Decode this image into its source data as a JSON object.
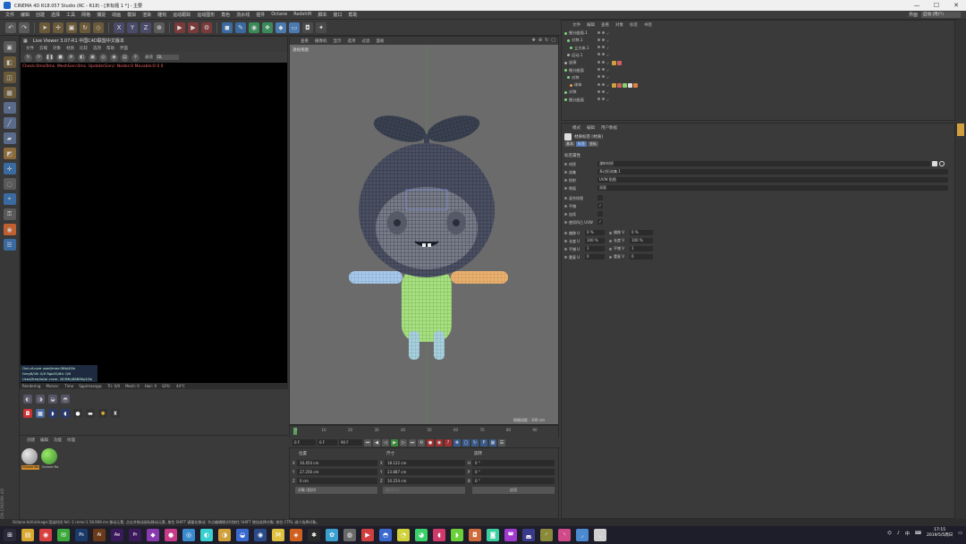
{
  "window": {
    "title": "CINEMA 4D R18.057 Studio (RC - R18) - [末标题 1 *] - 主要",
    "controls": [
      "—",
      "☐",
      "✕"
    ]
  },
  "menubar": {
    "items": [
      "文件",
      "编辑",
      "创建",
      "选择",
      "工具",
      "网格",
      "捕捉",
      "动画",
      "模拟",
      "渲染",
      "雕刻",
      "运动跟踪",
      "运动图形",
      "角色",
      "流水线",
      "插件",
      "Octane",
      "Redshift",
      "脚本",
      "窗口",
      "帮助"
    ],
    "layout_label": "界面",
    "layout_value": "启动 (用户)"
  },
  "toolbar": {
    "items": [
      {
        "name": "undo-icon",
        "glyph": "↶",
        "color": "#5a5a5a"
      },
      {
        "name": "redo-icon",
        "glyph": "↷",
        "color": "#5a5a5a"
      },
      {
        "name": "select-arrow-icon",
        "glyph": "➤",
        "color": "#6a5a3a"
      },
      {
        "name": "move-icon",
        "glyph": "✛",
        "color": "#6a5a3a"
      },
      {
        "name": "scale-icon",
        "glyph": "▣",
        "color": "#6a5a3a"
      },
      {
        "name": "rotate-icon",
        "glyph": "↻",
        "color": "#6a5a3a"
      },
      {
        "name": "recent-tool-icon",
        "glyph": "◇",
        "color": "#6a5a3a"
      },
      {
        "name": "x-axis-icon",
        "glyph": "X",
        "color": "#4a4a6a"
      },
      {
        "name": "y-axis-icon",
        "glyph": "Y",
        "color": "#4a4a6a"
      },
      {
        "name": "z-axis-icon",
        "glyph": "Z",
        "color": "#4a4a6a"
      },
      {
        "name": "coord-system-icon",
        "glyph": "⊕",
        "color": "#5a5a5a"
      },
      {
        "name": "render-view-icon",
        "glyph": "▶",
        "color": "#7a3a3a"
      },
      {
        "name": "render-picture-icon",
        "glyph": "▶",
        "color": "#7a3a3a"
      },
      {
        "name": "render-settings-icon",
        "glyph": "⚙",
        "color": "#7a3a3a"
      },
      {
        "name": "cube-icon",
        "glyph": "◼",
        "color": "#3a6aa0"
      },
      {
        "name": "pen-icon",
        "glyph": "✎",
        "color": "#3a6aa0"
      },
      {
        "name": "subdivision-icon",
        "glyph": "◉",
        "color": "#3a8a5a"
      },
      {
        "name": "cloner-icon",
        "glyph": "❖",
        "color": "#3a8a5a"
      },
      {
        "name": "deformer-icon",
        "glyph": "◆",
        "color": "#4a7ab0"
      },
      {
        "name": "floor-icon",
        "glyph": "▭",
        "color": "#4a7ab0"
      },
      {
        "name": "camera-icon",
        "glyph": "◘",
        "color": "#4a4a4a"
      },
      {
        "name": "light-icon",
        "glyph": "✦",
        "color": "#4a4a4a"
      }
    ]
  },
  "left_tools": [
    "make-editable-icon",
    "model-mode-icon",
    "texture-mode-icon",
    "workplane-icon",
    "point-mode-icon",
    "edge-mode-icon",
    "polygon-mode-icon",
    "uv-mode-icon",
    "axis-mode-icon",
    "soft-select-icon",
    "snap-icon",
    "lock-icon",
    "solo-icon",
    "layers-icon"
  ],
  "live_viewer": {
    "title": "Live Viewer 3.07-R1 中国C4D联盟中文版本",
    "menu": [
      "文件",
      "云端",
      "对象",
      "材质",
      "比较",
      "选项",
      "帮助",
      "界面"
    ],
    "tools_label": "通道",
    "channel": "DL",
    "status": "Check:0ms/0ms. MeshGen:0ms. Update(Gen): Nodes:0 Movable:0  0  0",
    "stats": [
      "Out-of-core used/max:0Kb/4Gb",
      "Grey8/16: 0/0          Rgb32/64: 0/0",
      "Used/free/total vram: 263Mb/888Mb/4Gb"
    ],
    "bottom": [
      "Rendering",
      "Ms/sec:",
      "Time",
      "Spp/maxspp:",
      "Tri: 0/0",
      "Mesh: 0",
      "Hair: 0",
      "GPU:",
      "44°C"
    ]
  },
  "materials": {
    "menu": [
      "创建",
      "编辑",
      "功能",
      "纹理"
    ],
    "items": [
      {
        "label": "Octane Ma",
        "color_a": "#e8e8e8",
        "color_b": "#888888"
      },
      {
        "label": "Octane Ma",
        "color_a": "#9ae86a",
        "color_b": "#3a8a2a"
      }
    ]
  },
  "viewport": {
    "menu": [
      "查看",
      "摄像机",
      "显示",
      "选项",
      "过滤",
      "面板"
    ],
    "camera_label": "透视视图",
    "grid_label": "网格间距 : 100 cm"
  },
  "timeline": {
    "ticks": [
      "0",
      "10",
      "20",
      "30",
      "40",
      "50",
      "60",
      "70",
      "80",
      "90"
    ],
    "current_frame": "0 F",
    "start": "0 F",
    "end": "90 F",
    "fps_field": "0 F"
  },
  "coordinates": {
    "headers": [
      "位置",
      "尺寸",
      "旋转"
    ],
    "position": {
      "x": "10.454 cm",
      "y": "27.256 cm",
      "z": "0 cm"
    },
    "size": {
      "x": "18.122 cm",
      "y": "23.887 cm",
      "z": "10.254 cm"
    },
    "rotation": {
      "h": "0 °",
      "p": "0 °",
      "b": "0 °"
    },
    "mode_left": "对象 (相对)",
    "mode_mid": "绝对尺寸",
    "apply_label": "应用"
  },
  "object_manager": {
    "menu": [
      "文件",
      "编辑",
      "查看",
      "对象",
      "标签",
      "书签"
    ],
    "rows": [
      {
        "name": "细分曲面.1",
        "indent": 0,
        "color": "#7fd67f",
        "tags": []
      },
      {
        "name": "对称.1",
        "indent": 1,
        "color": "#7fd67f",
        "tags": []
      },
      {
        "name": "立方体.1",
        "indent": 2,
        "color": "#7fd67f",
        "tags": []
      },
      {
        "name": "运动.1",
        "indent": 1,
        "color": "#aaa",
        "tags": []
      },
      {
        "name": "连接",
        "indent": 0,
        "color": "#aaa",
        "tags": [
          "#d0a040",
          "#d06060"
        ]
      },
      {
        "name": "细分曲面",
        "indent": 0,
        "color": "#7fd67f",
        "tags": []
      },
      {
        "name": "对称",
        "indent": 1,
        "color": "#7fd67f",
        "tags": []
      },
      {
        "name": "球体",
        "indent": 2,
        "color": "#e8a050",
        "tags": [
          "#d0a040",
          "#d06060",
          "#8ad06a",
          "#e0e0e0",
          "#e08040"
        ]
      },
      {
        "name": "对称",
        "indent": 0,
        "color": "#7fd67f",
        "tags": []
      },
      {
        "name": "细分曲面",
        "indent": 0,
        "color": "#7fd67f",
        "tags": []
      }
    ]
  },
  "attribute_manager": {
    "menu": [
      "模式",
      "编辑",
      "用户数据"
    ],
    "title": "材质标签 [材质]",
    "tabs": [
      "基本",
      "标签",
      "坐标"
    ],
    "active_tab": 1,
    "section": "标签属性",
    "material_label": "材质",
    "material_value": "漫射材质",
    "rows": [
      {
        "label": "选集",
        "value": "多边形选集.1"
      },
      {
        "label": "投射",
        "value": "UVW 贴图"
      },
      {
        "label": "侧面",
        "value": "双面"
      }
    ],
    "checks": [
      {
        "label": "混合纹理",
        "checked": false
      },
      {
        "label": "平铺",
        "checked": true
      },
      {
        "label": "连续",
        "checked": false
      },
      {
        "label": "使用凹凸 UVW",
        "checked": true
      }
    ],
    "pairs": [
      {
        "l1": "偏移 U",
        "v1": "0 %",
        "l2": "偏移 V",
        "v2": "0 %"
      },
      {
        "l1": "长度 U",
        "v1": "100 %",
        "l2": "长度 V",
        "v2": "100 %"
      },
      {
        "l1": "平铺 U",
        "v1": "1",
        "l2": "平铺 V",
        "v2": "1"
      },
      {
        "l1": "重复 U",
        "v1": "0",
        "l2": "重复 V",
        "v2": "0"
      }
    ]
  },
  "statusbar": {
    "text": "Octane:Init\\nUnage:渲染时间  fell -1   rnme:1  58.908 ms         移动元素, 点击并拖动鼠标移动元素, 按住 SHIFT 键量化移动; 节点编辑模式时按住 SHIFT 增加选择对象; 按住 CTRL 减少选择对象。"
  },
  "taskbar": {
    "icons": [
      {
        "name": "start-icon",
        "color": "#2a2a3a",
        "glyph": "⊞"
      },
      {
        "name": "explorer-icon",
        "color": "#d8a830",
        "glyph": "▤"
      },
      {
        "name": "browser-icon",
        "color": "#d84040",
        "glyph": "◉"
      },
      {
        "name": "wechat-icon",
        "color": "#3aa83a",
        "glyph": "✉"
      },
      {
        "name": "photoshop-icon",
        "color": "#1a3a6a",
        "glyph": "Ps"
      },
      {
        "name": "illustrator-icon",
        "color": "#6a3a1a",
        "glyph": "Ai"
      },
      {
        "name": "after-effects-icon",
        "color": "#3a1a5a",
        "glyph": "Ae"
      },
      {
        "name": "premiere-icon",
        "color": "#3a1a5a",
        "glyph": "Pr"
      },
      {
        "name": "app-icon",
        "color": "#8a3ab0",
        "glyph": "◆"
      },
      {
        "name": "app-icon",
        "color": "#c83a8a",
        "glyph": "●"
      },
      {
        "name": "app-icon",
        "color": "#3a8ad0",
        "glyph": "◎"
      },
      {
        "name": "app-icon",
        "color": "#3ad0d0",
        "glyph": "◐"
      },
      {
        "name": "app-icon",
        "color": "#d0a03a",
        "glyph": "◑"
      },
      {
        "name": "app-icon",
        "color": "#3a6ad0",
        "glyph": "◒"
      },
      {
        "name": "cinema4d-icon",
        "color": "#2a4a8a",
        "glyph": "◉"
      },
      {
        "name": "app-icon",
        "color": "#e0c040",
        "glyph": "M"
      },
      {
        "name": "app-icon",
        "color": "#d06020",
        "glyph": "◈"
      },
      {
        "name": "app-icon",
        "color": "#2a2a2a",
        "glyph": "✱"
      },
      {
        "name": "app-icon",
        "color": "#3aa0d0",
        "glyph": "✿"
      },
      {
        "name": "app-icon",
        "color": "#6a6a6a",
        "glyph": "◍"
      },
      {
        "name": "app-icon",
        "color": "#d04040",
        "glyph": "▶"
      },
      {
        "name": "app-icon",
        "color": "#3a6ad0",
        "glyph": "◓"
      },
      {
        "name": "app-icon",
        "color": "#d0d03a",
        "glyph": "◔"
      },
      {
        "name": "app-icon",
        "color": "#3ad06a",
        "glyph": "◕"
      },
      {
        "name": "app-icon",
        "color": "#d03a6a",
        "glyph": "◖"
      },
      {
        "name": "app-icon",
        "color": "#6ad03a",
        "glyph": "◗"
      },
      {
        "name": "app-icon",
        "color": "#d06a3a",
        "glyph": "◘"
      },
      {
        "name": "app-icon",
        "color": "#3ad0a0",
        "glyph": "◙"
      },
      {
        "name": "app-icon",
        "color": "#a03ad0",
        "glyph": "◚"
      },
      {
        "name": "app-icon",
        "color": "#3a3a8a",
        "glyph": "◛"
      },
      {
        "name": "app-icon",
        "color": "#8a8a3a",
        "glyph": "◜"
      },
      {
        "name": "app-icon",
        "color": "#d04a8a",
        "glyph": "◝"
      },
      {
        "name": "app-icon",
        "color": "#4a8ad0",
        "glyph": "◞"
      },
      {
        "name": "app-icon",
        "color": "#d0d0d0",
        "glyph": "◟"
      }
    ],
    "tray_lang": "中",
    "time": "17:15",
    "date": "2019/5/5周日"
  },
  "maxon_label": "MAXON CINEMA 4D"
}
